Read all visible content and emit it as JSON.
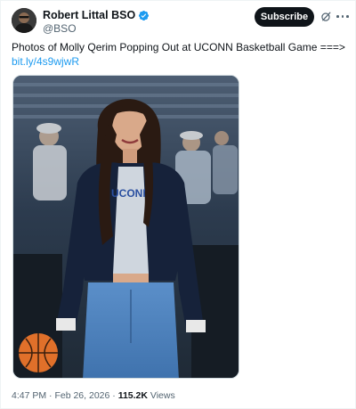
{
  "author": {
    "display_name": "Robert Littal BSO",
    "handle": "@BSO",
    "verified": true,
    "verified_color": "#1d9bf0"
  },
  "actions": {
    "subscribe_label": "Subscribe",
    "grok_icon": "grok-icon",
    "more_icon": "more-icon"
  },
  "tweet": {
    "text": "Photos of Molly Qerim Popping Out at UCONN Basketball Game ===>",
    "link": "bit.ly/4s9wjwR",
    "link_color": "#1d9bf0"
  },
  "media": {
    "jersey_text": "UCONN"
  },
  "meta": {
    "time": "4:47 PM",
    "separator": "·",
    "date": "Feb 26, 2026",
    "views_count": "115.2K",
    "views_label": "Views"
  },
  "colors": {
    "text_primary": "#0f1419",
    "text_secondary": "#536471",
    "subscribe_bg": "#0f1419"
  }
}
